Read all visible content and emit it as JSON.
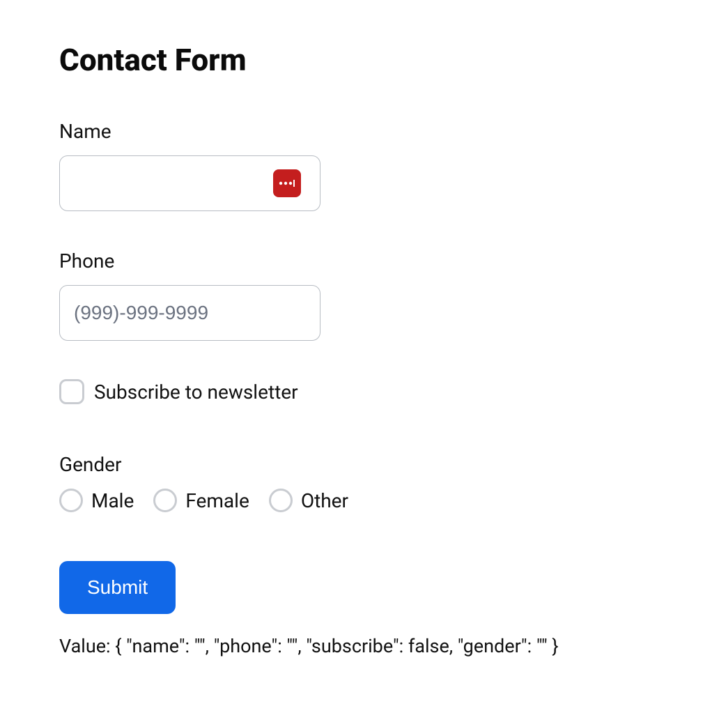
{
  "title": "Contact Form",
  "fields": {
    "name": {
      "label": "Name",
      "value": "",
      "placeholder": ""
    },
    "phone": {
      "label": "Phone",
      "value": "",
      "placeholder": "(999)-999-9999"
    },
    "subscribe": {
      "label": "Subscribe to newsletter",
      "checked": false
    },
    "gender": {
      "label": "Gender",
      "value": "",
      "options": [
        {
          "label": "Male"
        },
        {
          "label": "Female"
        },
        {
          "label": "Other"
        }
      ]
    }
  },
  "submit_label": "Submit",
  "value_dump": {
    "prefix": "Value: ",
    "text": "{ \"name\": \"\", \"phone\": \"\", \"subscribe\": false, \"gender\": \"\" }"
  }
}
